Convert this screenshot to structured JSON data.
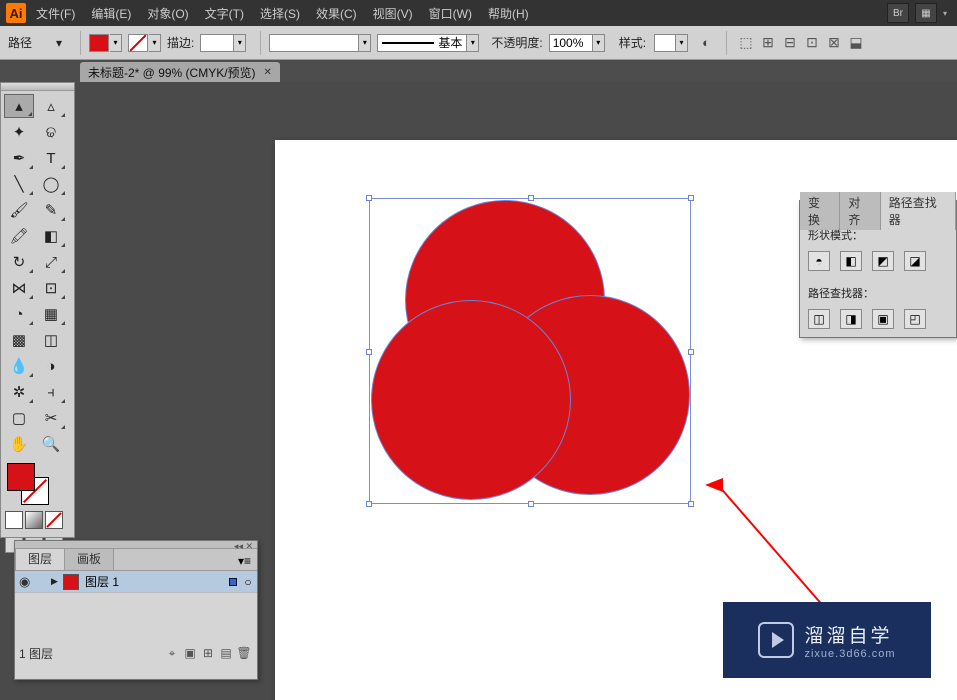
{
  "menubar": {
    "logo": "Ai",
    "items": [
      "文件(F)",
      "编辑(E)",
      "对象(O)",
      "文字(T)",
      "选择(S)",
      "效果(C)",
      "视图(V)",
      "窗口(W)",
      "帮助(H)"
    ],
    "br_label": "Br"
  },
  "controlbar": {
    "mode_label": "路径",
    "stroke_label": "描边:",
    "profile_label": "基本",
    "opacity_label": "不透明度:",
    "opacity_value": "100%",
    "style_label": "样式:"
  },
  "doc_tab": {
    "title": "未标题-2* @ 99% (CMYK/预览)"
  },
  "pathfinder": {
    "tabs": [
      "变换",
      "对齐",
      "路径查找器"
    ],
    "section1": "形状模式：",
    "section2": "路径查找器："
  },
  "layers": {
    "tabs": [
      "图层",
      "画板"
    ],
    "row": {
      "name": "图层 1"
    },
    "count": "1 图层"
  },
  "watermark": {
    "cn": "溜溜自学",
    "en": "zixue.3d66.com"
  },
  "tools": {
    "names": [
      "selection-tool",
      "direct-selection-tool",
      "magic-wand-tool",
      "lasso-tool",
      "pen-tool",
      "type-tool",
      "line-tool",
      "ellipse-tool",
      "paintbrush-tool",
      "pencil-tool",
      "blob-brush-tool",
      "eraser-tool",
      "rotate-tool",
      "scale-tool",
      "width-tool",
      "free-transform-tool",
      "shape-builder-tool",
      "perspective-grid-tool",
      "mesh-tool",
      "gradient-tool",
      "eyedropper-tool",
      "blend-tool",
      "symbol-sprayer-tool",
      "column-graph-tool",
      "artboard-tool",
      "slice-tool",
      "hand-tool",
      "zoom-tool"
    ]
  }
}
